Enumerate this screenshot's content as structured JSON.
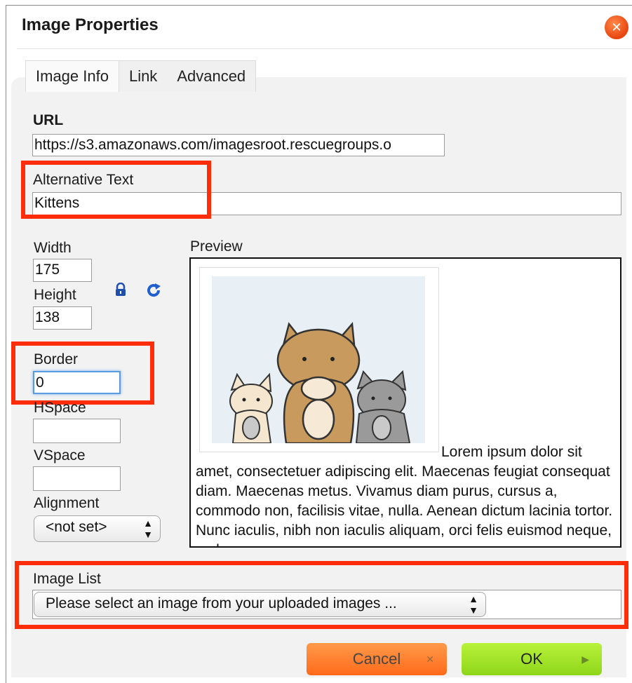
{
  "dialog": {
    "title": "Image Properties",
    "close_icon": "close-icon"
  },
  "tabs": [
    {
      "label": "Image Info",
      "active": true
    },
    {
      "label": "Link",
      "active": false
    },
    {
      "label": "Advanced",
      "active": false
    }
  ],
  "url": {
    "label": "URL",
    "value": "https://s3.amazonaws.com/imagesroot.rescuegroups.o"
  },
  "alt_text": {
    "label": "Alternative Text",
    "value": "Kittens"
  },
  "width": {
    "label": "Width",
    "value": "175"
  },
  "height": {
    "label": "Height",
    "value": "138"
  },
  "lock_icon": "lock-icon",
  "reset_icon": "reset-size-icon",
  "border": {
    "label": "Border",
    "value": "0"
  },
  "hspace": {
    "label": "HSpace",
    "value": ""
  },
  "vspace": {
    "label": "VSpace",
    "value": ""
  },
  "alignment": {
    "label": "Alignment",
    "value": "<not set>"
  },
  "preview": {
    "label": "Preview",
    "text": "Lorem ipsum dolor sit amet, consectetuer adipiscing elit. Maecenas feugiat consequat diam. Maecenas metus. Vivamus diam purus, cursus a, commodo non, facilisis vitae, nulla. Aenean dictum lacinia tortor. Nunc iaculis, nibh non iaculis aliquam, orci felis euismod neque, sed ornare"
  },
  "image_list": {
    "label": "Image List",
    "value": "Please select an image from your uploaded images ..."
  },
  "buttons": {
    "cancel": "Cancel",
    "ok": "OK"
  },
  "colors": {
    "highlight": "#ff2d0a",
    "cancel": "#ff7a2a",
    "ok": "#a6e42a"
  }
}
